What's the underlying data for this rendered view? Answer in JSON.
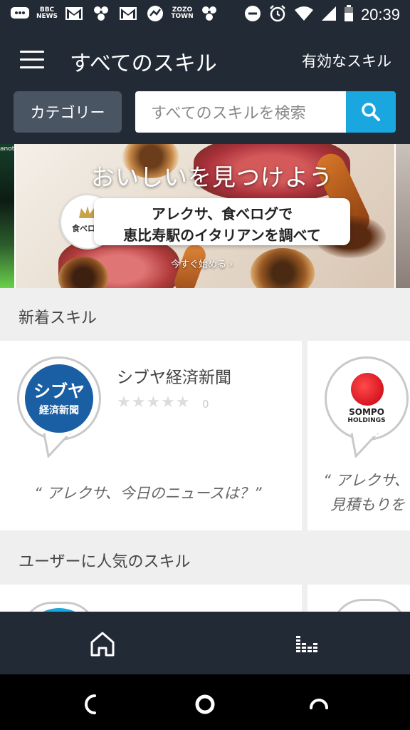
{
  "status_bar": {
    "left_icons": [
      "message-icon",
      "bbc-news-icon",
      "gmail-icon",
      "pinwheel-icon",
      "gmail-icon",
      "stocks-icon",
      "zozotown-icon",
      "pinwheel-icon"
    ],
    "bbc_label": "BBC NEWS",
    "zozo_label": "ZOZO TOWN",
    "time": "20:39"
  },
  "app_bar": {
    "title": "すべてのスキル",
    "enabled_skills": "有効なスキル"
  },
  "search": {
    "category_label": "カテゴリー",
    "placeholder": "すべてのスキルを検索"
  },
  "banner": {
    "peek_left_text": "anoto",
    "headline": "おいしいを見つけよう",
    "line1": "アレクサ、食べログで",
    "line2": "恵比寿駅のイタリアンを調べて",
    "logo_text": "食べログ",
    "cta": "今すぐ始める ›"
  },
  "sections": {
    "new_skills": "新着スキル",
    "popular_skills": "ユーザーに人気のスキル"
  },
  "new_skill_cards": [
    {
      "icon_line1": "シブヤ",
      "icon_line2": "経済新聞",
      "name": "シブヤ経済新聞",
      "stars": "★★★★★",
      "rating_count": "0",
      "quote": "“ アレクサ、今日のニュースは？”"
    },
    {
      "icon_line1": "SOMPO",
      "icon_line2": "HOLDINGS",
      "quote_line1": "“ アレクサ、",
      "quote_line2": "見積もりを"
    }
  ],
  "colors": {
    "header_bg": "#222a35",
    "accent": "#1aa7e0",
    "category_bg": "#4a5563"
  }
}
